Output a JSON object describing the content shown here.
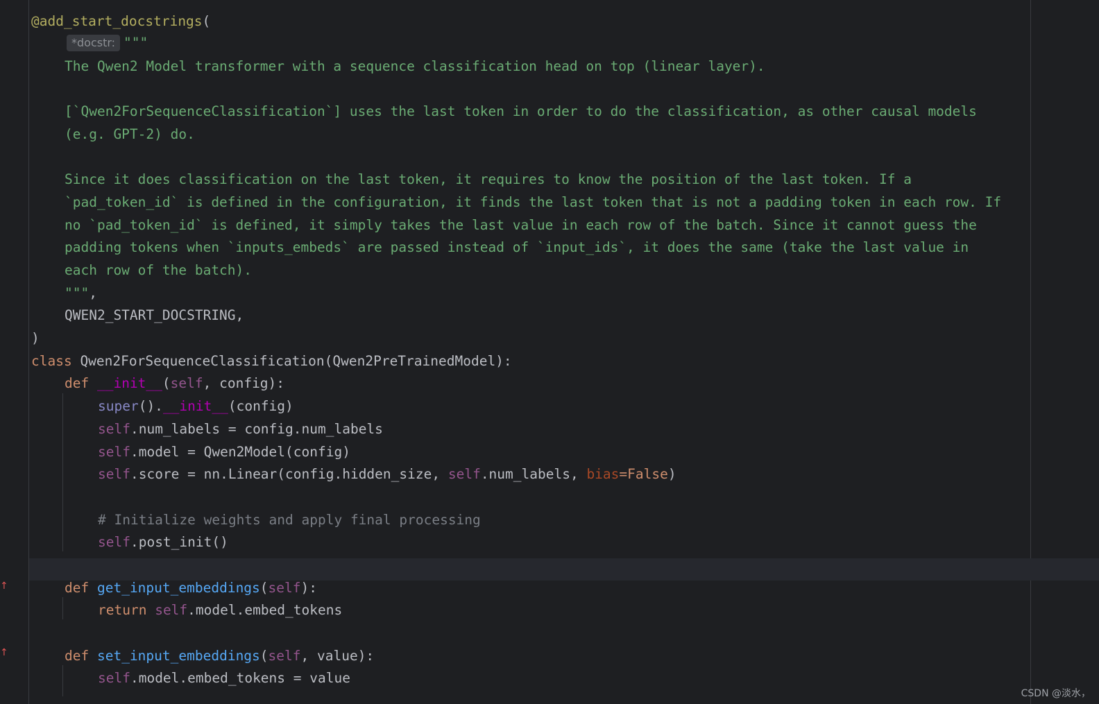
{
  "code": {
    "decorator_name": "@add_start_docstrings",
    "open_paren": "(",
    "inlay_hint": "*docstr:",
    "doc_open_quotes": "\"\"\"",
    "doc_line_1": "The Qwen2 Model transformer with a sequence classification head on top (linear layer).",
    "doc_line_2": "[`Qwen2ForSequenceClassification`] uses the last token in order to do the classification, as other causal models",
    "doc_line_3": "(e.g. GPT-2) do.",
    "doc_line_4": "Since it does classification on the last token, it requires to know the position of the last token. If a",
    "doc_line_5": "`pad_token_id` is defined in the configuration, it finds the last token that is not a padding token in each row. If",
    "doc_line_6": "no `pad_token_id` is defined, it simply takes the last value in each row of the batch. Since it cannot guess the",
    "doc_line_7": "padding tokens when `inputs_embeds` are passed instead of `input_ids`, it does the same (take the last value in",
    "doc_line_8": "each row of the batch).",
    "doc_close_quotes": "\"\"\"",
    "doc_close_comma": ",",
    "start_docstring_arg": "QWEN2_START_DOCSTRING,",
    "close_paren": ")",
    "kw_class": "class",
    "class_signature": " Qwen2ForSequenceClassification(Qwen2PreTrainedModel):",
    "kw_def": "def",
    "init_name": "__init__",
    "self_word": "self",
    "init_params_open": "(",
    "init_params_rest": ", config):",
    "super_call": "super",
    "super_rest": "().",
    "super_args": "(config)",
    "num_labels_assign": ".num_labels = config.num_labels",
    "model_assign": ".model = Qwen2Model(config)",
    "score_assign_start": ".score = nn.Linear(config.hidden_size, ",
    "score_assign_mid": ".num_labels, ",
    "bias_kw": "bias",
    "bias_value": "=False",
    "score_close": ")",
    "comment_init": "# Initialize weights and apply final processing",
    "post_init_call": ".post_init()",
    "get_embeddings_name": "get_input_embeddings",
    "get_embeddings_params_close": "):",
    "kw_return": "return",
    "return_rest": ".model.embed_tokens",
    "set_embeddings_name": "set_input_embeddings",
    "set_embeddings_params_rest": ", value):",
    "set_assign": ".model.embed_tokens = value",
    "paren_open": "(",
    "space": " "
  },
  "gutter": {
    "override_marker_1": "↑",
    "override_marker_2": "↑"
  },
  "watermark": "CSDN @淡水，",
  "colors": {
    "background": "#1e1f22",
    "keyword": "#cf8e6d",
    "docstring": "#6aab73",
    "self": "#94558d",
    "magic_method": "#b200b2",
    "function": "#56a8f5",
    "comment": "#7a7e85",
    "decorator": "#b3ae60"
  }
}
